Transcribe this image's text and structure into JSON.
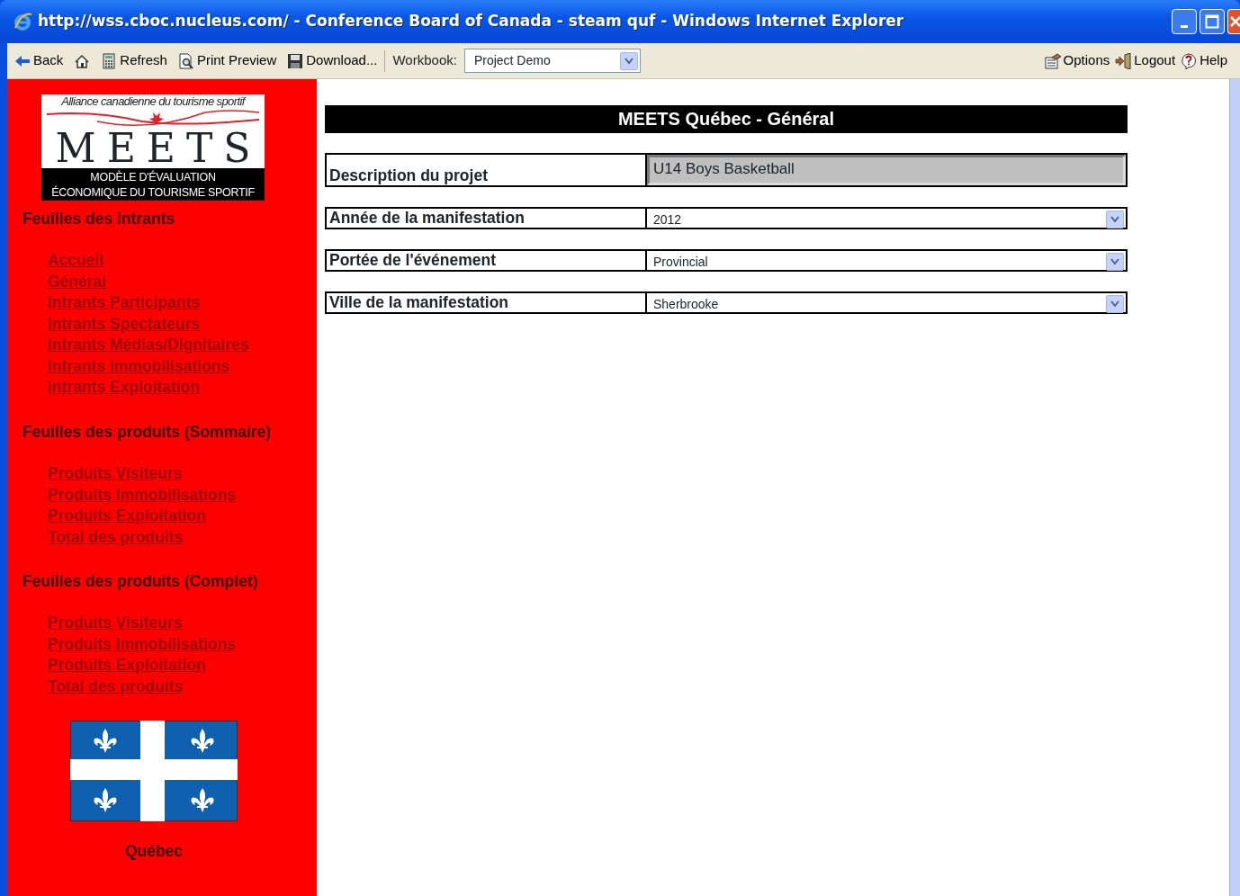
{
  "window": {
    "title": "http://wss.cboc.nucleus.com/ - Conference Board of Canada -  steam quf - Windows Internet Explorer"
  },
  "toolbar": {
    "left": [
      {
        "kind": "back",
        "label": "Back"
      },
      {
        "kind": "home"
      },
      {
        "kind": "refresh",
        "label": "Refresh"
      },
      {
        "kind": "preview",
        "label": "Print Preview"
      },
      {
        "kind": "download",
        "label": "Download..."
      }
    ],
    "workbook_label": "Workbook:",
    "workbook_value": "Project Demo",
    "right": [
      {
        "kind": "options",
        "label": "Options"
      },
      {
        "kind": "logout",
        "label": "Logout"
      },
      {
        "kind": "help",
        "label": "Help"
      }
    ]
  },
  "sidebar": {
    "logo": {
      "tagline": "Alliance canadienne du tourisme sportif",
      "title": "MEETS",
      "subtitle_1": "MODÈLE D'ÉVALUATION",
      "subtitle_2": "ÉCONOMIQUE DU TOURISME SPORTIF"
    },
    "sections": [
      {
        "heading": "Feuilles des intrants",
        "links": [
          "Accueil",
          "Général",
          "Intrants Participants",
          "Intrants Spectateurs",
          "Intrants Médias/Dignitaires",
          "Intrants Immobilisations",
          "Intrants Exploitation"
        ]
      },
      {
        "heading": "Feuilles des produits (Sommaire)",
        "links": [
          "Produits Visiteurs",
          "Produits Immobilisations",
          "Produits Exploitation",
          "Total des produits"
        ]
      },
      {
        "heading": "Feuilles des produits (Complet)",
        "links": [
          "Produits Visiteurs",
          "Produits Immobilisations",
          "Produits Exploitation",
          "Total des produits"
        ]
      }
    ],
    "flag_caption": "Québec"
  },
  "form": {
    "title": "MEETS Québec - Général",
    "fields": [
      {
        "kind": "text",
        "label": "Description du projet",
        "value": "U14 Boys Basketball"
      },
      {
        "kind": "select",
        "label": "Année de la manifestation",
        "value": "2012"
      },
      {
        "kind": "select",
        "label": "Portée de l'événement",
        "value": "Provincial"
      },
      {
        "kind": "select",
        "label": "Ville de la manifestation",
        "value": "Sherbrooke"
      }
    ]
  }
}
